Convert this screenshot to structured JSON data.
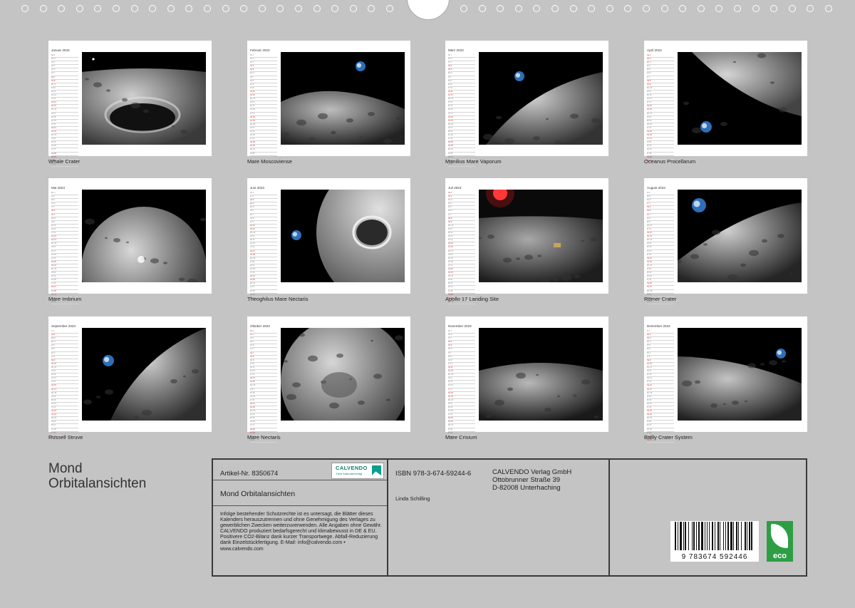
{
  "cover_title": [
    "Mond",
    "Orbitalansichten"
  ],
  "year": "2023",
  "months": [
    {
      "name": "Januar",
      "caption": "Whale Crater"
    },
    {
      "name": "Februar",
      "caption": "Mare Moscoviense"
    },
    {
      "name": "März",
      "caption": "Manilius Mare Vaporum"
    },
    {
      "name": "April",
      "caption": "Oceanus Procellarum"
    },
    {
      "name": "Mai",
      "caption": "Mare Imbrium"
    },
    {
      "name": "Juni",
      "caption": "Theoghilus Mare Nectaris"
    },
    {
      "name": "Juli",
      "caption": "Apollo 17 Landing Site"
    },
    {
      "name": "August",
      "caption": "Römer Crater"
    },
    {
      "name": "September",
      "caption": "Russell Struve"
    },
    {
      "name": "Oktober",
      "caption": "Mare Nectaris"
    },
    {
      "name": "November",
      "caption": "Mare Crisium"
    },
    {
      "name": "Dezember",
      "caption": "Bailly Crater System"
    }
  ],
  "info": {
    "article": "Artikel-Nr. 8350674",
    "publisher_logo_name": "CALVENDO",
    "publisher_logo_tagline": "Dein Kalenderverlag",
    "calendar_title": "Mond Orbitalansichten",
    "legal_text": "Infolge bestehender Schutzrechte ist es untersagt, die Blätter dieses Kalenders herauszutrennen und ohne Genehmigung des Verlages zu gewerblichen Zwecken weiterzuverwenden. Alle Angaben ohne Gewähr. CALVENDO produziert bedarfsgerecht und klimabewusst in DE & EU. Positivere CO2-Bilanz dank kurzer Transportwege. Abfall-Reduzierung dank Einzelstückfertigung. E-Mail: info@calvendo.com • www.calvendo.com",
    "isbn": "ISBN 978-3-674-59244-6",
    "author": "Linda Schilling",
    "publisher_address": [
      "CALVENDO Verlag GmbH",
      "Ottobrunner Straße 39",
      "D-82008 Unterhaching"
    ],
    "barcode_number": "9 783674 592446",
    "eco_label": "eco"
  },
  "colors": {
    "background": "#c4c4c4",
    "weekend": "#d02a2a",
    "calvendo": "#0d7d74",
    "eco": "#2e9e45"
  }
}
